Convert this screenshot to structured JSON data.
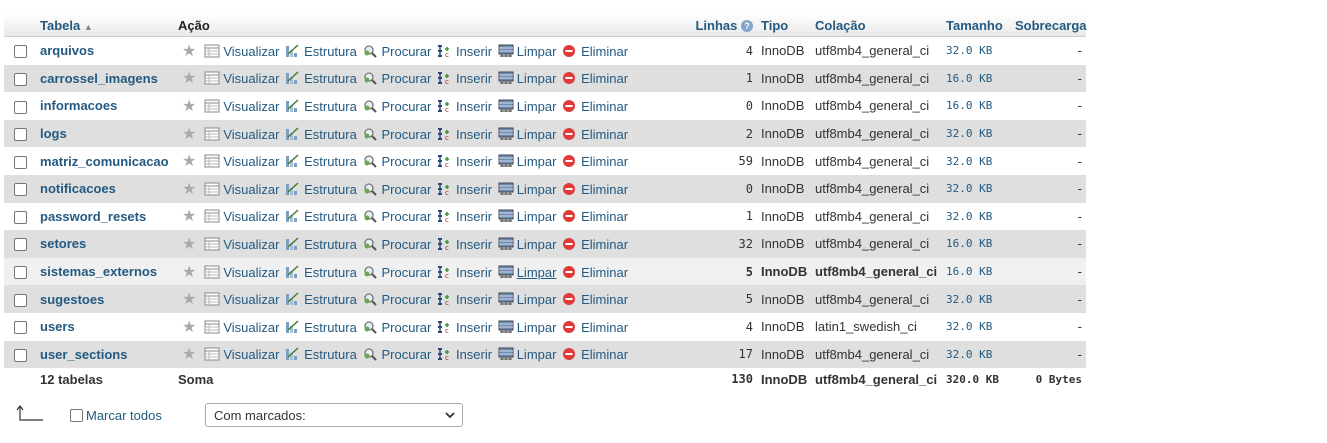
{
  "headers": {
    "table": "Tabela",
    "action": "Ação",
    "rows": "Linhas",
    "type": "Tipo",
    "collation": "Colação",
    "size": "Tamanho",
    "overhead": "Sobrecarga"
  },
  "actions": {
    "browse": "Visualizar",
    "structure": "Estrutura",
    "search": "Procurar",
    "insert": "Inserir",
    "empty": "Limpar",
    "drop": "Eliminar"
  },
  "rows": [
    {
      "name": "arquivos",
      "rows": "4",
      "type": "InnoDB",
      "collation": "utf8mb4_general_ci",
      "size": "32.0 KB",
      "overhead": "-"
    },
    {
      "name": "carrossel_imagens",
      "rows": "1",
      "type": "InnoDB",
      "collation": "utf8mb4_general_ci",
      "size": "16.0 KB",
      "overhead": "-"
    },
    {
      "name": "informacoes",
      "rows": "0",
      "type": "InnoDB",
      "collation": "utf8mb4_general_ci",
      "size": "16.0 KB",
      "overhead": "-"
    },
    {
      "name": "logs",
      "rows": "2",
      "type": "InnoDB",
      "collation": "utf8mb4_general_ci",
      "size": "32.0 KB",
      "overhead": "-"
    },
    {
      "name": "matriz_comunicacao",
      "rows": "59",
      "type": "InnoDB",
      "collation": "utf8mb4_general_ci",
      "size": "32.0 KB",
      "overhead": "-"
    },
    {
      "name": "notificacoes",
      "rows": "0",
      "type": "InnoDB",
      "collation": "utf8mb4_general_ci",
      "size": "32.0 KB",
      "overhead": "-"
    },
    {
      "name": "password_resets",
      "rows": "1",
      "type": "InnoDB",
      "collation": "utf8mb4_general_ci",
      "size": "32.0 KB",
      "overhead": "-"
    },
    {
      "name": "setores",
      "rows": "32",
      "type": "InnoDB",
      "collation": "utf8mb4_general_ci",
      "size": "16.0 KB",
      "overhead": "-"
    },
    {
      "name": "sistemas_externos",
      "rows": "5",
      "type": "InnoDB",
      "collation": "utf8mb4_general_ci",
      "size": "16.0 KB",
      "overhead": "-"
    },
    {
      "name": "sugestoes",
      "rows": "5",
      "type": "InnoDB",
      "collation": "utf8mb4_general_ci",
      "size": "32.0 KB",
      "overhead": "-"
    },
    {
      "name": "users",
      "rows": "4",
      "type": "InnoDB",
      "collation": "latin1_swedish_ci",
      "size": "32.0 KB",
      "overhead": "-"
    },
    {
      "name": "user_sections",
      "rows": "17",
      "type": "InnoDB",
      "collation": "utf8mb4_general_ci",
      "size": "32.0 KB",
      "overhead": "-"
    }
  ],
  "summary": {
    "count": "12 tabelas",
    "sum_label": "Soma",
    "rows": "130",
    "type": "InnoDB",
    "collation": "utf8mb4_general_ci",
    "size": "320.0 KB",
    "overhead": "0 Bytes"
  },
  "footer": {
    "mark_all": "Marcar todos",
    "with_selected": "Com marcados:"
  },
  "colors": {
    "link": "#235a81",
    "row_even": "#dfdfdf",
    "drop_red": "#e03b3b"
  }
}
